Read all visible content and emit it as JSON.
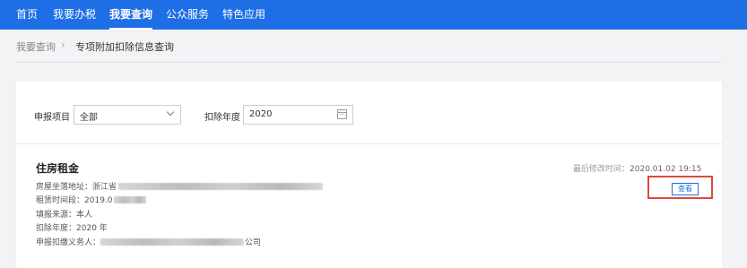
{
  "nav": {
    "items": [
      "首页",
      "我要办税",
      "我要查询",
      "公众服务",
      "特色应用"
    ],
    "active_index": 2
  },
  "breadcrumb": {
    "parent": "我要查询",
    "separator": "›",
    "current": "专项附加扣除信息查询"
  },
  "filters": {
    "declare_item_label": "申报项目",
    "declare_item_value": "全部",
    "year_label": "扣除年度",
    "year_value": "2020"
  },
  "record": {
    "title": "住房租金",
    "last_modified_label": "最后修改时间：",
    "last_modified_value": "2020.01.02 19:15",
    "view_button": "查看",
    "fields": {
      "address_label": "房屋坐落地址：",
      "address_value": "浙江省",
      "lease_period_label": "租赁时间段：",
      "lease_period_value": "2019.0",
      "source_label": "填报来源：",
      "source_value": "本人",
      "deduction_year_label": "扣除年度：",
      "deduction_year_value": "2020 年",
      "withholder_label": "申报扣缴义务人：",
      "withholder_value": "公司"
    }
  },
  "colors": {
    "nav_bg": "#1e6ee6",
    "accent": "#1e6ee6",
    "highlight_border": "#e0483c"
  }
}
